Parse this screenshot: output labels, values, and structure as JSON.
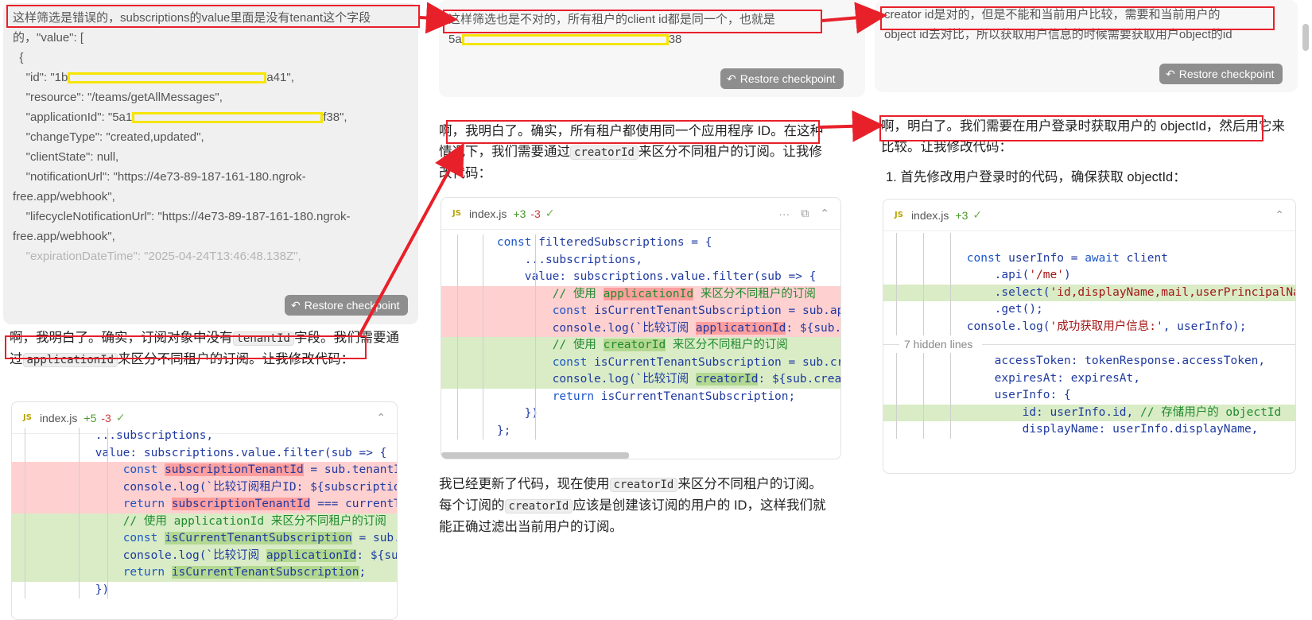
{
  "col1": {
    "user_note": "这样筛选是错误的，subscriptions的value里面是没有tenant这个字段的，\"value\": [",
    "json_lines": [
      "  {",
      "    \"id\": \"1b",
      "    \"resource\": \"/teams/getAllMessages\",",
      "    \"applicationId\": \"5a1",
      "    \"changeType\": \"created,updated\",",
      "    \"clientState\": null,",
      "    \"notificationUrl\": \"https://4e73-89-187-161-180.ngrok-",
      "free.app/webhook\",",
      "    \"lifecycleNotificationUrl\": \"https://4e73-89-187-161-180.ngrok-",
      "free.app/webhook\",",
      "    \"expirationDateTime\": \"2025-04-24T13:46:48.138Z\","
    ],
    "json_tail_id": "a41\",",
    "json_tail_app": "f38\",",
    "restore": "Restore checkpoint",
    "ai_text_1": "啊，我明白了。确实，订阅对象中没有",
    "ai_chip_1": "tenantId",
    "ai_text_2": "字段。我们需要通过",
    "ai_chip_2": "applicationId",
    "ai_text_3": "来区分不同租户的订阅。让我修改代码：",
    "file": {
      "name": "index.js",
      "plus": "+5",
      "minus": "-3",
      "badge": "JS"
    },
    "code": [
      "            ...subscriptions,",
      "            value: subscriptions.value.filter(sub => {",
      "                const subscriptionTenantId = sub.tenantId;",
      "                console.log(`比较订阅租户ID: ${subscriptionTenantId}`);",
      "                return subscriptionTenantId === currentTenantId;",
      "                // 使用 applicationId 来区分不同租户的订阅",
      "                const isCurrentTenantSubscription = sub.applicationId === clientId;",
      "                console.log(`比较订阅 applicationId: ${sub.applicationId}`);",
      "                return isCurrentTenantSubscription;",
      "            })"
    ]
  },
  "col2": {
    "user_note": "这样筛选也是不对的，所有租户的client id都是同一个，也就是",
    "id_prefix": "5a",
    "id_suffix": "38",
    "restore": "Restore checkpoint",
    "ai_text_1": "啊，我明白了。确实，所有租户都使用同一个应用程序 ID。在这种情况下，我们需要通过",
    "ai_chip_1": "creatorId",
    "ai_text_2": "来区分不同租户的订阅。让我修改代码：",
    "file": {
      "name": "index.js",
      "plus": "+3",
      "minus": "-3",
      "badge": "JS"
    },
    "code": [
      "        const filteredSubscriptions = {",
      "            ...subscriptions,",
      "            value: subscriptions.value.filter(sub => {",
      "                // 使用 applicationId 来区分不同租户的订阅",
      "                const isCurrentTenantSubscription = sub.applicationId === clientId;",
      "                console.log(`比较订阅 applicationId: ${sub.applicationId}`);",
      "                // 使用 creatorId 来区分不同租户的订阅",
      "                const isCurrentTenantSubscription = sub.creatorId === userId;",
      "                console.log(`比较订阅 creatorId: ${sub.creatorId}`);",
      "                return isCurrentTenantSubscription;",
      "            })",
      "        };"
    ],
    "summary_1": "我已经更新了代码，现在使用",
    "summary_chip_1": "creatorId",
    "summary_2": "来区分不同租户的订阅。每个订阅的",
    "summary_chip_2": "creatorId",
    "summary_3": "应该是创建该订阅的用户的 ID，这样我们就能正确过滤出当前用户的订阅。"
  },
  "col3": {
    "user_note_1": "creator id是对的，但是不能和当前用户比较，需要和当前用户的",
    "user_note_2": "object id去对比，所以获取用户信息的时候需要获取用户object的id",
    "restore": "Restore checkpoint",
    "ai_text_1": "啊，明白了。我们需要在用户登录时获取用户的 objectId，然后用它来比较。让我修改代码：",
    "step_1": "1. 首先修改用户登录时的代码，确保获取 objectId：",
    "file": {
      "name": "index.js",
      "plus": "+3",
      "badge": "JS"
    },
    "code_top": [
      "",
      "            const userInfo = await client",
      "                .api('/me')",
      "                .select('id,displayName,mail,userPrincipalName')",
      "                .get();",
      "            console.log('成功获取用户信息:', userInfo);"
    ],
    "hidden": "7 hidden lines",
    "code_bottom": [
      "                accessToken: tokenResponse.accessToken,",
      "                expiresAt: expiresAt,",
      "                userInfo: {",
      "                    id: userInfo.id, // 存储用户的 objectId",
      "                    displayName: userInfo.displayName,"
    ]
  }
}
